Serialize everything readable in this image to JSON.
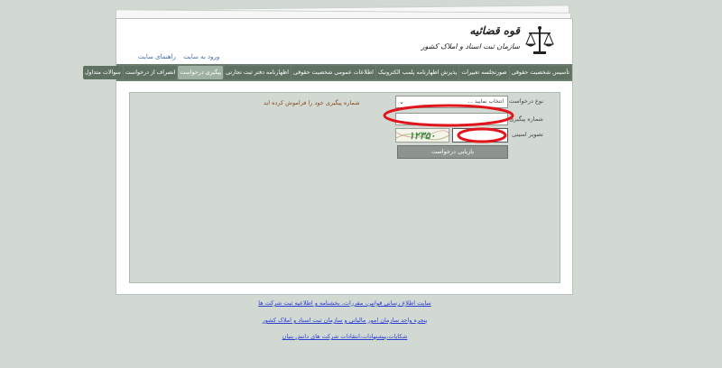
{
  "brand": {
    "title": "قوه قضائیه",
    "subtitle": "سازمان ثبت اسناد و املاک کشور"
  },
  "top_links": [
    "ورود به سایت",
    "راهنمای سایت"
  ],
  "nav": {
    "tabs": [
      {
        "label": "تأسیس شخصیت حقوقی",
        "active": false
      },
      {
        "label": "صورتجلسه تغییرات",
        "active": false
      },
      {
        "label": "پذیرش اظهارنامه پلمب الکترونیک",
        "active": false
      },
      {
        "label": "اطلاعات عمومی شخصیت حقوقی",
        "active": false
      },
      {
        "label": "اظهارنامه دفتر ثبت تجارتی",
        "active": false
      },
      {
        "label": "پیگیری درخواست",
        "active": true
      },
      {
        "label": "انصراف از درخواست",
        "active": false
      },
      {
        "label": "سوالات متداول",
        "active": false
      }
    ]
  },
  "form": {
    "request_type_label": "نوع درخواست",
    "request_type_value": "انتخاب نمایید ...",
    "tracking_label": "شماره پیگیری",
    "tracking_value": "",
    "captcha_label": "تصویر امنیتی",
    "captcha_text": "۱۲۳۵۰",
    "captcha_value": "",
    "forgot_link": "شماره پیگیری خود را فراموش کرده اید",
    "submit_label": "بازیابی درخواست"
  },
  "footer": {
    "links": [
      "سایت اطلاع رسانی قوانین، مقررات، بخشنامه و اطلاعیه ثبت شرکت ها",
      "پنجره واحد سازمان امور مالیاتی و سازمان ثبت اسناد و املاک کشور",
      "شکایات،پیشنهادات،انتقادات شرکت های دانش بنیان"
    ]
  },
  "colors": {
    "background": "#d2d9d3",
    "nav": "#6b7d6e",
    "nav_active": "#9fb2a2",
    "link": "#2a3fd0",
    "annotation": "#e0161c"
  }
}
